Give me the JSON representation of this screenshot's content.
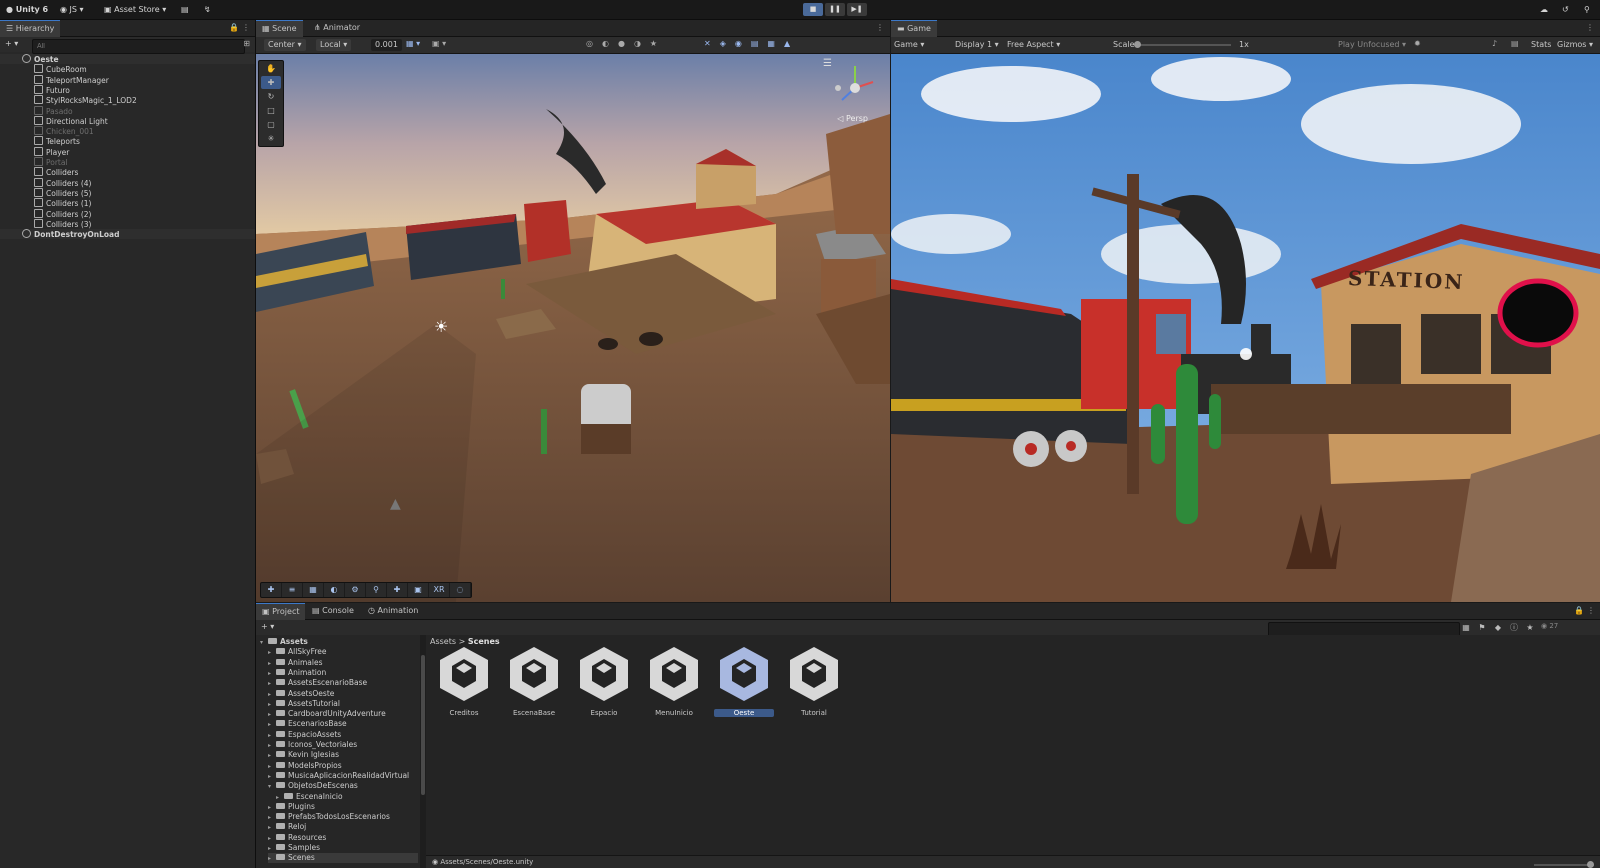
{
  "toolbar": {
    "app_label": "Unity 6",
    "account_label": "JS",
    "asset_store_label": "Asset Store",
    "play_icon": "play-icon",
    "pause_icon": "pause-icon",
    "step_icon": "step-icon"
  },
  "hierarchy": {
    "tab_label": "Hierarchy",
    "search_placeholder": "All",
    "items": [
      {
        "label": "Oeste",
        "type": "scene",
        "dim": false
      },
      {
        "label": "CubeRoom",
        "dim": false
      },
      {
        "label": "TeleportManager",
        "dim": false
      },
      {
        "label": "Futuro",
        "dim": false
      },
      {
        "label": "StylRocksMagic_1_LOD2",
        "dim": false
      },
      {
        "label": "Pasado",
        "dim": true
      },
      {
        "label": "Directional Light",
        "dim": false
      },
      {
        "label": "Chicken_001",
        "dim": true
      },
      {
        "label": "Teleports",
        "dim": false
      },
      {
        "label": "Player",
        "dim": false
      },
      {
        "label": "Portal",
        "dim": true
      },
      {
        "label": "Colliders",
        "dim": false
      },
      {
        "label": "Colliders (4)",
        "dim": false
      },
      {
        "label": "Colliders (5)",
        "dim": false
      },
      {
        "label": "Colliders (1)",
        "dim": false
      },
      {
        "label": "Colliders (2)",
        "dim": false
      },
      {
        "label": "Colliders (3)",
        "dim": false
      },
      {
        "label": "DontDestroyOnLoad",
        "type": "scene",
        "dim": false
      }
    ]
  },
  "scene_panel": {
    "tabs": [
      {
        "label": "Scene"
      },
      {
        "label": "Animator"
      }
    ],
    "pivot_label": "Center",
    "space_label": "Local",
    "snap_value": "0.001",
    "persp_label": "◁ Persp"
  },
  "game_panel": {
    "tab_label": "Game",
    "mode_label": "Game",
    "display_label": "Display 1",
    "aspect_label": "Free Aspect",
    "scale_label": "Scale",
    "scale_value": "1x",
    "play_focus_label": "Play Unfocused",
    "stats_label": "Stats",
    "gizmos_label": "Gizmos",
    "sign_text": "STATION"
  },
  "project_panel": {
    "tabs": [
      {
        "label": "Project"
      },
      {
        "label": "Console"
      },
      {
        "label": "Animation"
      }
    ],
    "tree": [
      {
        "label": "Assets",
        "root": true
      },
      {
        "label": "AllSkyFree"
      },
      {
        "label": "Animales"
      },
      {
        "label": "Animation"
      },
      {
        "label": "AssetsEscenarioBase"
      },
      {
        "label": "AssetsOeste"
      },
      {
        "label": "AssetsTutorial"
      },
      {
        "label": "CardboardUnityAdventure"
      },
      {
        "label": "EscenariosBase"
      },
      {
        "label": "EspacioAssets"
      },
      {
        "label": "Iconos_Vectoriales"
      },
      {
        "label": "Kevin Iglesias"
      },
      {
        "label": "ModelsPropios"
      },
      {
        "label": "MusicaAplicacionRealidadVirtual"
      },
      {
        "label": "ObjetosDeEscenas"
      },
      {
        "label": "EscenaInicio",
        "child": true
      },
      {
        "label": "Plugins"
      },
      {
        "label": "PrefabsTodosLosEscenarios"
      },
      {
        "label": "Reloj"
      },
      {
        "label": "Resources"
      },
      {
        "label": "Samples"
      },
      {
        "label": "Scenes",
        "selected": true
      }
    ],
    "breadcrumb": {
      "root": "Assets",
      "separator": ">",
      "current": "Scenes"
    },
    "assets": [
      {
        "label": "Creditos"
      },
      {
        "label": "EscenaBase"
      },
      {
        "label": "Espacio"
      },
      {
        "label": "MenuInicio"
      },
      {
        "label": "Oeste",
        "selected": true
      },
      {
        "label": "Tutorial"
      }
    ],
    "status_path": "Assets/Scenes/Oeste.unity",
    "hidden_count": "27"
  },
  "colors": {
    "accent": "#3c78c8",
    "selection": "#3c5a8a",
    "portal_ring": "#e0104a"
  }
}
